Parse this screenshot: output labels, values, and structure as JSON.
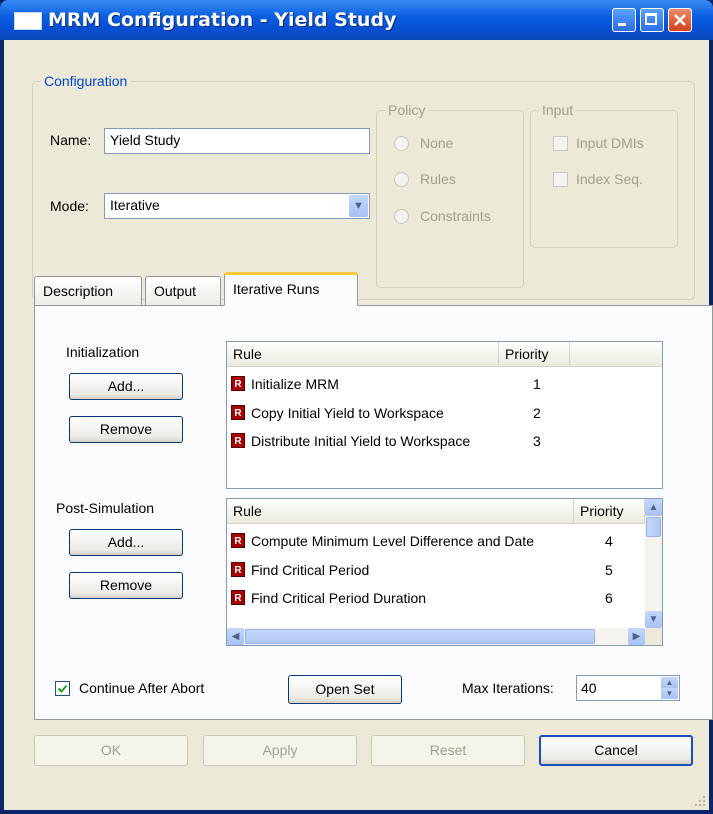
{
  "window": {
    "title": "MRM Configuration - Yield Study"
  },
  "configuration": {
    "group_label": "Configuration",
    "name_label": "Name:",
    "name_value": "Yield Study",
    "mode_label": "Mode:",
    "mode_value": "Iterative",
    "policy": {
      "label": "Policy",
      "options": [
        "None",
        "Rules",
        "Constraints"
      ]
    },
    "input": {
      "label": "Input",
      "options": [
        "Input DMIs",
        "Index Seq."
      ]
    }
  },
  "tabs": [
    "Description",
    "Output",
    "Iterative Runs"
  ],
  "iterative": {
    "initialization": {
      "label": "Initialization",
      "add_label": "Add...",
      "remove_label": "Remove",
      "columns": [
        "Rule",
        "Priority"
      ],
      "rows": [
        {
          "rule": "Initialize MRM",
          "priority": "1"
        },
        {
          "rule": "Copy Initial Yield to Workspace",
          "priority": "2"
        },
        {
          "rule": "Distribute Initial Yield to Workspace",
          "priority": "3"
        }
      ]
    },
    "post_simulation": {
      "label": "Post-Simulation",
      "add_label": "Add...",
      "remove_label": "Remove",
      "columns": [
        "Rule",
        "Priority"
      ],
      "rows": [
        {
          "rule": "Compute Minimum Level Difference and Date",
          "priority": "4"
        },
        {
          "rule": "Find Critical Period",
          "priority": "5"
        },
        {
          "rule": "Find Critical Period Duration",
          "priority": "6"
        }
      ]
    },
    "continue_after_abort": {
      "label": "Continue After Abort",
      "checked": true
    },
    "open_set_label": "Open Set",
    "max_iterations_label": "Max Iterations:",
    "max_iterations_value": "40"
  },
  "footer": {
    "ok": "OK",
    "apply": "Apply",
    "reset": "Reset",
    "cancel": "Cancel"
  },
  "icons": {
    "rule": "rule-icon",
    "rule_letter": "R"
  },
  "colors": {
    "title_bar": "#0a5fe0",
    "dialog_bg": "#ece9d8",
    "active_tab_accent": "#ffc83c",
    "link_blue": "#0046d5"
  }
}
